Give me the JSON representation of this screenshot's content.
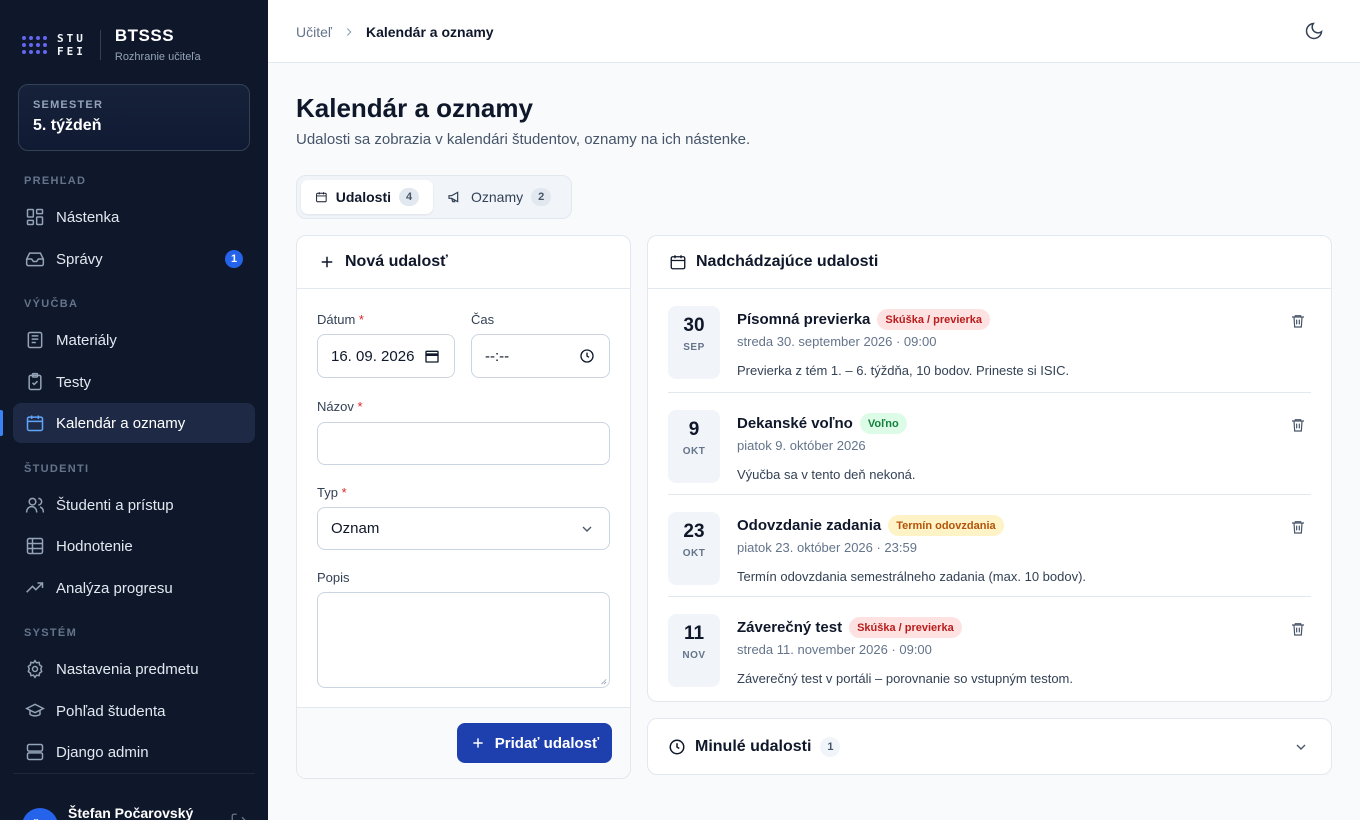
{
  "brand": {
    "logo_text_1": "STU",
    "logo_text_2": "FEI",
    "title": "BTSSS",
    "subtitle": "Rozhranie učiteľa"
  },
  "semester": {
    "label": "SEMESTER",
    "value": "5. týždeň"
  },
  "sidebar": {
    "sections": [
      "PREHĽAD",
      "VÝUČBA",
      "ŠTUDENTI",
      "SYSTÉM"
    ],
    "items": [
      {
        "label": "Nástenka",
        "icon": "dashboard-icon"
      },
      {
        "label": "Správy",
        "icon": "inbox-icon",
        "badge": "1"
      },
      {
        "label": "Materiály",
        "icon": "book-icon"
      },
      {
        "label": "Testy",
        "icon": "clipboard-check-icon"
      },
      {
        "label": "Kalendár a oznamy",
        "icon": "calendar-icon",
        "active": true
      },
      {
        "label": "Študenti a prístup",
        "icon": "users-icon"
      },
      {
        "label": "Hodnotenie",
        "icon": "grid-icon"
      },
      {
        "label": "Analýza progresu",
        "icon": "trending-up-icon"
      },
      {
        "label": "Nastavenia predmetu",
        "icon": "gear-icon"
      },
      {
        "label": "Pohľad študenta",
        "icon": "graduation-cap-icon"
      },
      {
        "label": "Django admin",
        "icon": "server-icon"
      }
    ]
  },
  "user": {
    "initials": "ŠP",
    "name": "Štefan Počarovský"
  },
  "breadcrumb": {
    "parent": "Učiteľ",
    "current": "Kalendár a oznamy"
  },
  "page": {
    "title": "Kalendár a oznamy",
    "subtitle": "Udalosti sa zobrazia v kalendári študentov, oznamy na ich nástenke."
  },
  "tabs": [
    {
      "label": "Udalosti",
      "count": "4",
      "active": true
    },
    {
      "label": "Oznamy",
      "count": "2",
      "active": false
    }
  ],
  "form": {
    "title": "Nová udalosť",
    "date_label": "Dátum",
    "date_value": "16. 09. 2026",
    "time_label": "Čas",
    "time_value": "--:--",
    "name_label": "Názov",
    "name_value": "",
    "type_label": "Typ",
    "type_value": "Oznam",
    "desc_label": "Popis",
    "desc_value": "",
    "required_mark": "*",
    "submit_label": "Pridať udalosť"
  },
  "events": {
    "title": "Nadchádzajúce udalosti",
    "items": [
      {
        "day": "30",
        "month": "SEP",
        "title": "Písomná previerka",
        "badge": "Skúška / previerka",
        "badge_color": "#b91c1c",
        "date": "streda 30. september 2026 · 09:00",
        "desc": "Previerka z tém 1. – 6. týždňa, 10 bodov. Prineste si ISIC."
      },
      {
        "day": "9",
        "month": "OKT",
        "title": "Dekanské voľno",
        "badge": "Voľno",
        "badge_color": "#15803d",
        "date": "piatok 9. október 2026",
        "desc": "Výučba sa v tento deň nekoná."
      },
      {
        "day": "23",
        "month": "OKT",
        "title": "Odovzdanie zadania",
        "badge": "Termín odovzdania",
        "badge_color": "#b45309",
        "date": "piatok 23. október 2026 · 23:59",
        "desc": "Termín odovzdania semestrálneho zadania (max. 10 bodov)."
      },
      {
        "day": "11",
        "month": "NOV",
        "title": "Záverečný test",
        "badge": "Skúška / previerka",
        "badge_color": "#b91c1c",
        "date": "streda 11. november 2026 · 09:00",
        "desc": "Záverečný test v portáli – porovnanie so vstupným testom."
      }
    ]
  },
  "past_events": {
    "title": "Minulé udalosti",
    "count": "1"
  },
  "colors": {
    "sidebar_bg": "#0f172a",
    "accent": "#1e40af",
    "active_indicator": "#3b82f6"
  }
}
